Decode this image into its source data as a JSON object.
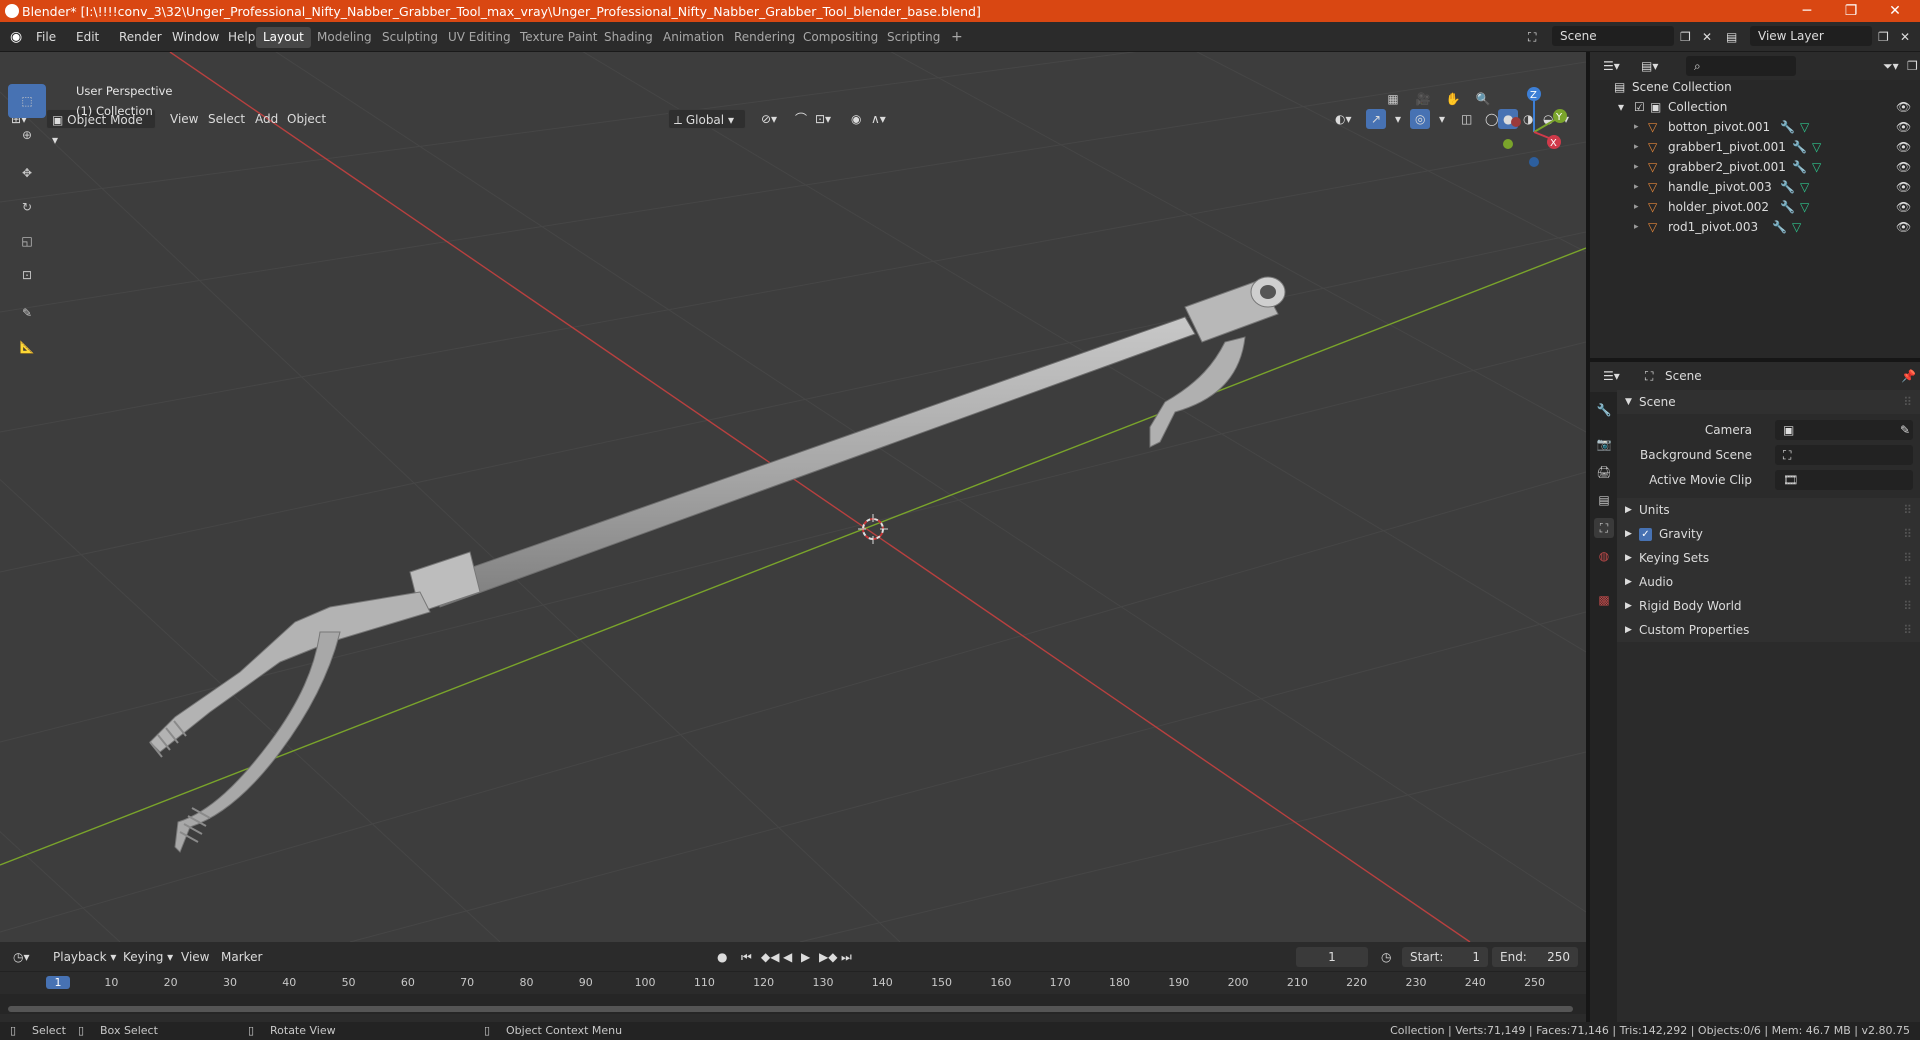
{
  "title": "Blender* [I:\\!!!!conv_3\\32\\Unger_Professional_Nifty_Nabber_Grabber_Tool_max_vray\\Unger_Professional_Nifty_Nabber_Grabber_Tool_blender_base.blend]",
  "window_controls": {
    "minimize": "─",
    "maximize": "❐",
    "close": "✕"
  },
  "menu": [
    "File",
    "Edit",
    "Render",
    "Window",
    "Help"
  ],
  "workspaces": [
    "Layout",
    "Modeling",
    "Sculpting",
    "UV Editing",
    "Texture Paint",
    "Shading",
    "Animation",
    "Rendering",
    "Compositing",
    "Scripting"
  ],
  "active_workspace": "Layout",
  "add_workspace": "+",
  "scene_name": "Scene",
  "view_layer": "View Layer",
  "viewport_header": {
    "mode": "Object Mode",
    "menus": [
      "View",
      "Select",
      "Add",
      "Object"
    ],
    "orientation": "Global"
  },
  "viewport_overlay": {
    "perspective": "User Perspective",
    "collection": "(1) Collection"
  },
  "gizmo": {
    "x": "X",
    "y": "Y",
    "z": "Z"
  },
  "outliner": {
    "root": "Scene Collection",
    "collection": "Collection",
    "objects": [
      "botton_pivot.001",
      "grabber1_pivot.001",
      "grabber2_pivot.001",
      "handle_pivot.003",
      "holder_pivot.002",
      "rod1_pivot.003"
    ]
  },
  "properties": {
    "context": "Scene",
    "panel": "Scene",
    "fields": [
      {
        "label": "Camera"
      },
      {
        "label": "Background Scene"
      },
      {
        "label": "Active Movie Clip"
      }
    ],
    "sections": [
      "Units",
      "Gravity",
      "Keying Sets",
      "Audio",
      "Rigid Body World",
      "Custom Properties"
    ],
    "gravity_checked": true
  },
  "timeline": {
    "menus": [
      "Playback",
      "Keying",
      "View",
      "Marker"
    ],
    "current_frame": "1",
    "start_label": "Start:",
    "start": "1",
    "end_label": "End:",
    "end": "250",
    "ticks": [
      "1",
      "10",
      "20",
      "30",
      "40",
      "50",
      "60",
      "70",
      "80",
      "90",
      "100",
      "110",
      "120",
      "130",
      "140",
      "150",
      "160",
      "170",
      "180",
      "190",
      "200",
      "210",
      "220",
      "230",
      "240",
      "250"
    ]
  },
  "statusbar": {
    "select": "Select",
    "box_select": "Box Select",
    "rotate": "Rotate View",
    "context_menu": "Object Context Menu",
    "stats": "Collection | Verts:71,149 | Faces:71,146 | Tris:142,292 | Objects:0/6 | Mem: 46.7 MB | v2.80.75"
  },
  "colors": {
    "title_bar": "#d94712",
    "active_tool": "#4772b3",
    "x_axis": "#b8403f",
    "y_axis": "#7aa42b",
    "z_axis": "#3d7fd6",
    "mesh_icon": "#e5873a",
    "data_icon": "#2fc48c"
  }
}
